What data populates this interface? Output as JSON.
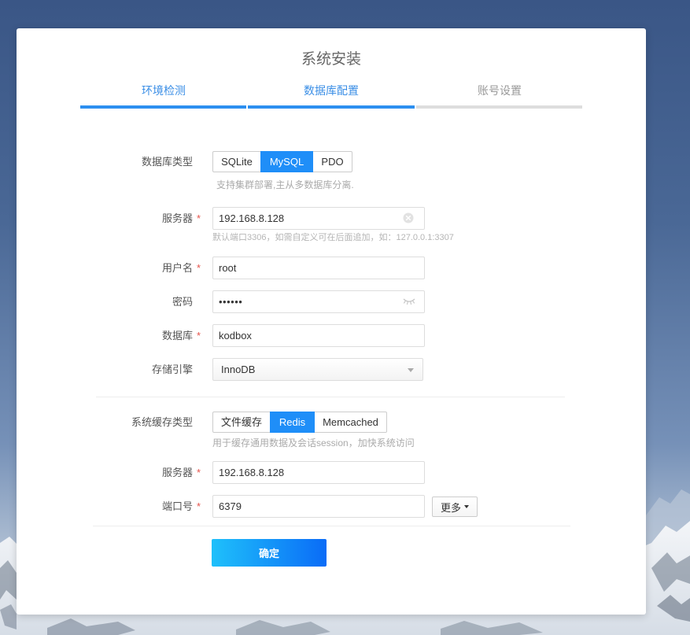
{
  "page": {
    "title": "系统安装"
  },
  "steps": [
    {
      "label": "环境检测",
      "state": "done"
    },
    {
      "label": "数据库配置",
      "state": "active"
    },
    {
      "label": "账号设置",
      "state": "pending"
    }
  ],
  "form": {
    "required_mark": "*"
  },
  "database": {
    "type": {
      "label": "数据库类型",
      "options": [
        "SQLite",
        "MySQL",
        "PDO"
      ],
      "selected": "MySQL",
      "hint": "支持集群部署,主从多数据库分离."
    },
    "server": {
      "label": "服务器",
      "required": true,
      "value": "192.168.8.128",
      "hint": "默认端口3306，如需自定义可在后面追加，如：127.0.0.1:3307"
    },
    "username": {
      "label": "用户名",
      "required": true,
      "value": "root"
    },
    "password": {
      "label": "密码",
      "required": false,
      "value": "••••••"
    },
    "name": {
      "label": "数据库",
      "required": true,
      "value": "kodbox"
    },
    "engine": {
      "label": "存储引擎",
      "value": "InnoDB"
    }
  },
  "cache": {
    "type": {
      "label": "系统缓存类型",
      "options": [
        "文件缓存",
        "Redis",
        "Memcached"
      ],
      "selected": "Redis",
      "hint": "用于缓存通用数据及会话session，加快系统访问"
    },
    "server": {
      "label": "服务器",
      "required": true,
      "value": "192.168.8.128"
    },
    "port": {
      "label": "端口号",
      "required": true,
      "value": "6379"
    },
    "more_label": "更多"
  },
  "actions": {
    "submit_label": "确定"
  },
  "icons": {
    "server_clear": "clear-circle-icon",
    "password_toggle": "eye-off-icon",
    "engine_select": "chevron-down-icon",
    "more_menu": "caret-down-icon"
  },
  "colors": {
    "accent": "#1f8ef8",
    "step_active": "#3a8ee6",
    "step_pending": "#dddddd",
    "required": "#e5534b",
    "submit_gradient_start": "#1fc0fa",
    "submit_gradient_end": "#0a6cf7"
  }
}
